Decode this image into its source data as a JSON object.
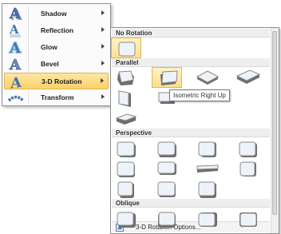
{
  "effects_menu": {
    "items": [
      {
        "label": "Shadow",
        "icon": "shadow-effect-icon"
      },
      {
        "label": "Reflection",
        "icon": "reflection-effect-icon"
      },
      {
        "label": "Glow",
        "icon": "glow-effect-icon"
      },
      {
        "label": "Bevel",
        "icon": "bevel-effect-icon"
      },
      {
        "label": "3-D Rotation",
        "icon": "3d-rotation-effect-icon"
      },
      {
        "label": "Transform",
        "icon": "transform-effect-icon"
      }
    ],
    "highlighted": "3-D Rotation"
  },
  "rotation_gallery": {
    "sections": [
      {
        "title": "No Rotation",
        "presets": 1
      },
      {
        "title": "Parallel",
        "presets": 7
      },
      {
        "title": "Perspective",
        "presets": 11
      },
      {
        "title": "Oblique",
        "presets": 4
      }
    ],
    "selected": "No Rotation",
    "tooltip": "Isometric Right Up",
    "footer_label": "3-D Rotation Options...",
    "footer_icon": "options-icon"
  },
  "colors": {
    "highlight": "#fbd26a",
    "shape_face": "#eef3f9",
    "shape_edge": "#7d7d7d",
    "letter_blue": "#4a74ad"
  }
}
